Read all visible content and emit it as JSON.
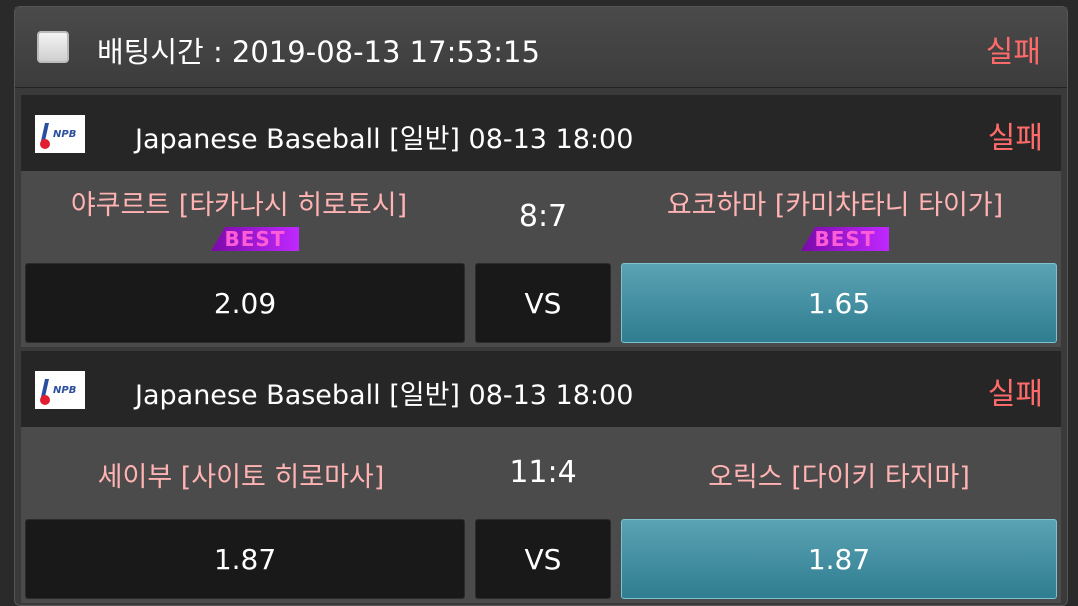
{
  "header": {
    "title": "배팅시간 : 2019-08-13 17:53:15",
    "result": "실패"
  },
  "games": [
    {
      "league": "Japanese Baseball  [일반]  08-13 18:00",
      "result": "실패",
      "home_team": "야쿠르트 [타카나시 히로토시]",
      "away_team": "요코하마 [카미차타니 타이가]",
      "score": "8:7",
      "home_badge": "BEST",
      "away_badge": "BEST",
      "home_odds": "2.09",
      "vs_label": "VS",
      "away_odds": "1.65"
    },
    {
      "league": "Japanese Baseball  [일반]  08-13 18:00",
      "result": "실패",
      "home_team": "세이부 [사이토 히로마사]",
      "away_team": "오릭스 [다이키 타지마]",
      "score": "11:4",
      "home_odds": "1.87",
      "vs_label": "VS",
      "away_odds": "1.87"
    }
  ],
  "colors": {
    "fail_red": "#ff6a6a",
    "team_pink": "#ffb3b3",
    "selected_teal": "#3f8fa3",
    "badge_purple": "#a020f0"
  },
  "icons": {
    "league_logo": "npb-logo-icon",
    "checkbox": "checkbox-icon"
  }
}
